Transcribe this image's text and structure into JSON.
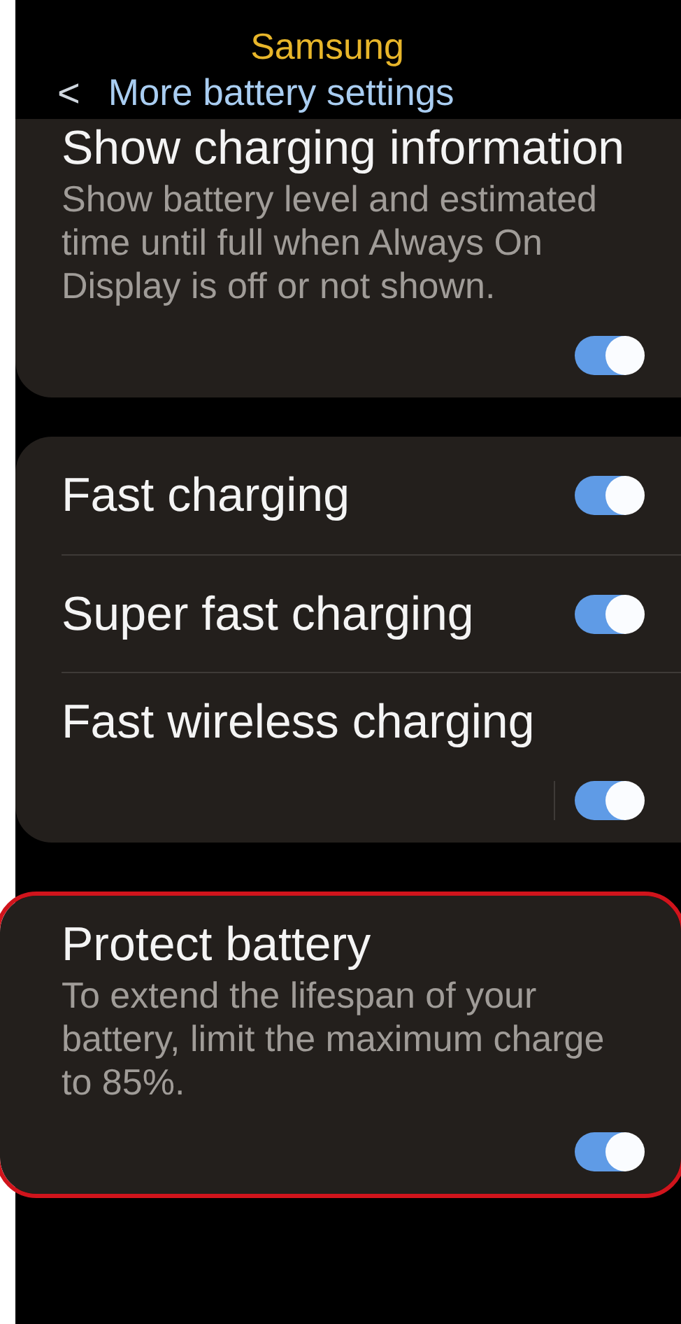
{
  "brand": "Samsung",
  "header": {
    "back": "<",
    "title": "More battery settings"
  },
  "cards": [
    {
      "highlighted": false,
      "items": [
        {
          "kind": "stacked",
          "title": "Show charging information",
          "description": "Show battery level and estimated time until full when Always On Display is off or not shown.",
          "on": true,
          "separator": false
        }
      ]
    },
    {
      "highlighted": false,
      "items": [
        {
          "kind": "inline",
          "title": "Fast charging",
          "on": true
        },
        {
          "kind": "inline",
          "title": "Super fast charging",
          "on": true
        },
        {
          "kind": "stacked",
          "title": "Fast wireless charging",
          "on": true,
          "separator": true
        }
      ]
    },
    {
      "highlighted": true,
      "items": [
        {
          "kind": "stacked",
          "title": "Protect battery",
          "description": "To extend the lifespan of your battery, limit the maximum charge to 85%.",
          "on": true,
          "separator": false
        }
      ]
    }
  ]
}
